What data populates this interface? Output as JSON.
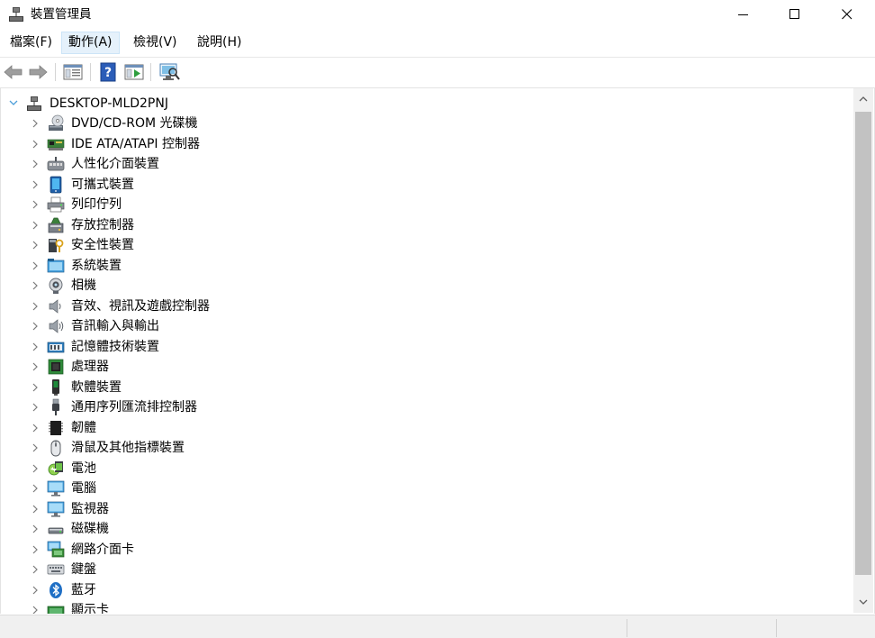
{
  "window": {
    "title": "裝置管理員",
    "icon": "device-manager-icon"
  },
  "menu": [
    {
      "label": "檔案(F)"
    },
    {
      "label": "動作(A)"
    },
    {
      "label": "檢視(V)"
    },
    {
      "label": "說明(H)"
    }
  ],
  "toolbar": [
    "back-arrow-icon",
    "forward-arrow-icon",
    "properties-icon",
    "help-icon",
    "run-icon",
    "scan-hardware-icon"
  ],
  "tree": {
    "root": "DESKTOP-MLD2PNJ",
    "items": [
      {
        "label": "DVD/CD-ROM 光碟機",
        "icon": "dvd-drive-icon"
      },
      {
        "label": "IDE ATA/ATAPI 控制器",
        "icon": "ide-controller-icon"
      },
      {
        "label": "人性化介面裝置",
        "icon": "hid-icon"
      },
      {
        "label": "可攜式裝置",
        "icon": "portable-device-icon"
      },
      {
        "label": "列印佇列",
        "icon": "printer-icon"
      },
      {
        "label": "存放控制器",
        "icon": "storage-controller-icon"
      },
      {
        "label": "安全性裝置",
        "icon": "security-device-icon"
      },
      {
        "label": "系統裝置",
        "icon": "system-device-icon"
      },
      {
        "label": "相機",
        "icon": "camera-icon"
      },
      {
        "label": "音效、視訊及遊戲控制器",
        "icon": "sound-icon"
      },
      {
        "label": "音訊輸入與輸出",
        "icon": "audio-io-icon"
      },
      {
        "label": "記憶體技術裝置",
        "icon": "memory-icon"
      },
      {
        "label": "處理器",
        "icon": "processor-icon"
      },
      {
        "label": "軟體裝置",
        "icon": "software-device-icon"
      },
      {
        "label": "通用序列匯流排控制器",
        "icon": "usb-icon"
      },
      {
        "label": "韌體",
        "icon": "firmware-icon"
      },
      {
        "label": "滑鼠及其他指標裝置",
        "icon": "mouse-icon"
      },
      {
        "label": "電池",
        "icon": "battery-icon"
      },
      {
        "label": "電腦",
        "icon": "computer-icon"
      },
      {
        "label": "監視器",
        "icon": "monitor-icon"
      },
      {
        "label": "磁碟機",
        "icon": "disk-drive-icon"
      },
      {
        "label": "網路介面卡",
        "icon": "network-adapter-icon"
      },
      {
        "label": "鍵盤",
        "icon": "keyboard-icon"
      },
      {
        "label": "藍牙",
        "icon": "bluetooth-icon"
      },
      {
        "label": "顯示卡",
        "icon": "display-adapter-icon"
      }
    ]
  },
  "colors": {
    "accent": "#0078d7",
    "menu_hover": "#e5f1fb"
  }
}
